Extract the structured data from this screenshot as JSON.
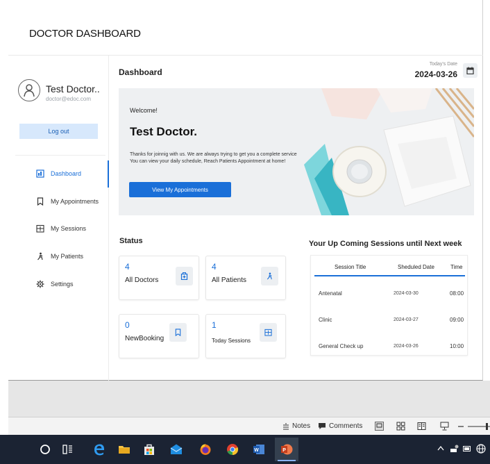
{
  "slide": {
    "title": "DOCTOR DASHBOARD"
  },
  "sidebar": {
    "user_name": "Test Doctor..",
    "user_email": "doctor@edoc.com",
    "logout_label": "Log out",
    "items": [
      {
        "label": "Dashboard",
        "icon": "dashboard-icon",
        "active": true
      },
      {
        "label": "My Appointments",
        "icon": "bookmark-icon"
      },
      {
        "label": "My Sessions",
        "icon": "schedule-icon"
      },
      {
        "label": "My Patients",
        "icon": "patient-icon"
      },
      {
        "label": "Settings",
        "icon": "gear-icon"
      }
    ]
  },
  "header": {
    "title": "Dashboard",
    "today_label": "Today's Date",
    "today_date": "2024-03-26"
  },
  "welcome": {
    "greeting": "Welcome!",
    "name": "Test Doctor.",
    "line1": "Thanks for joinnig with us. We are always trying to get you a complete service",
    "line2": "You can view your daily schedule, Reach Patients Appointment at home!",
    "button": "View My Appointments"
  },
  "status": {
    "title": "Status",
    "cards": [
      {
        "count": "4",
        "label": "All Doctors",
        "icon": "doctor-icon"
      },
      {
        "count": "4",
        "label": "All Patients",
        "icon": "patient-icon"
      },
      {
        "count": "0",
        "label": "NewBooking",
        "icon": "bookmark-icon"
      },
      {
        "count": "1",
        "label": "Today Sessions",
        "icon": "schedule-icon"
      }
    ]
  },
  "upcoming": {
    "title": "Your Up Coming Sessions until Next week",
    "columns": [
      "Session Title",
      "Sheduled Date",
      "Time"
    ],
    "rows": [
      [
        "Antenatal",
        "2024-03-30",
        "08:00"
      ],
      [
        "Clinic",
        "2024-03-27",
        "09:00"
      ],
      [
        "General Check up",
        "2024-03-26",
        "10:00"
      ]
    ]
  },
  "statusbar": {
    "notes": "Notes",
    "comments": "Comments"
  },
  "colors": {
    "accent": "#1a6fd8",
    "logout_bg": "#d7e8fc",
    "taskbar": "#1b2333"
  }
}
